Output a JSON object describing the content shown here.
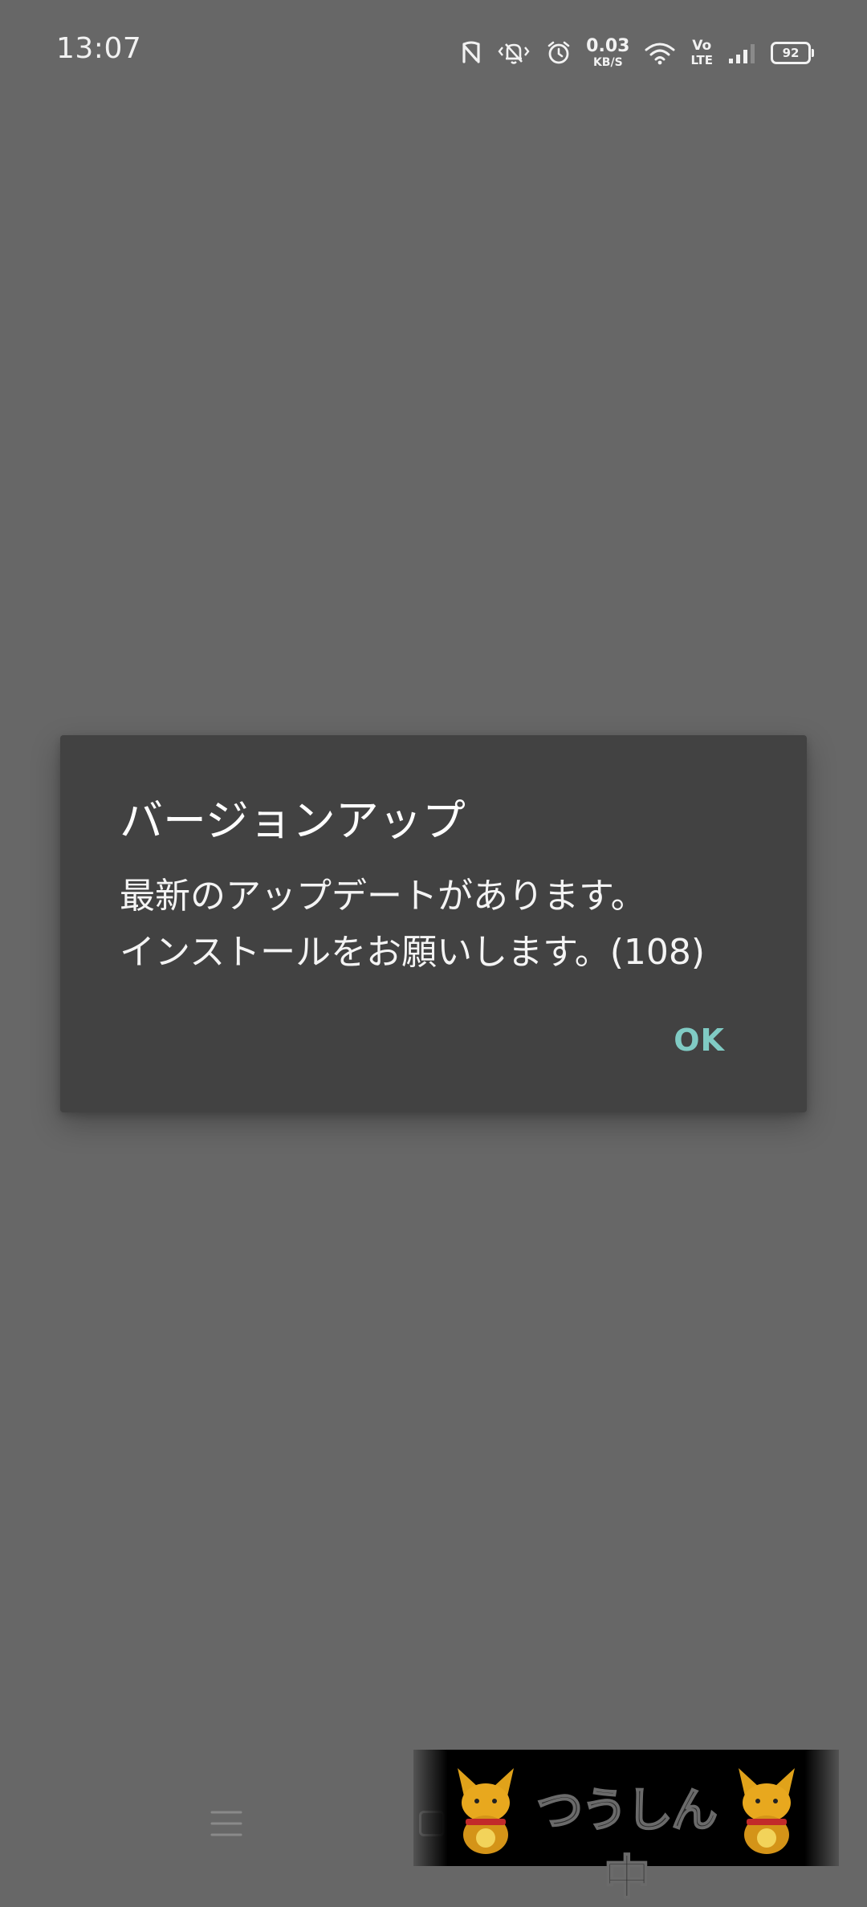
{
  "status_bar": {
    "time": "13:07",
    "net_speed_value": "0.03",
    "net_speed_unit": "KB/S",
    "volte_top": "Vo",
    "volte_bottom": "LTE",
    "battery_level": "92",
    "icons": [
      "nfc-icon",
      "vibrate-icon",
      "alarm-icon",
      "wifi-icon",
      "volte-icon",
      "signal-icon",
      "battery-icon"
    ]
  },
  "dialog": {
    "title": "バージョンアップ",
    "message_line1": "最新のアップデートがあります。",
    "message_line2": "インストールをお願いします。(108)",
    "ok_label": "OK",
    "accent_color": "#80cbc4",
    "background_color": "#424242"
  },
  "nav_bar": {
    "icons": [
      "menu-icon",
      "home-icon",
      "back-icon"
    ]
  },
  "banner": {
    "text": "つうしん中"
  },
  "colors": {
    "page_background": "#676767"
  }
}
